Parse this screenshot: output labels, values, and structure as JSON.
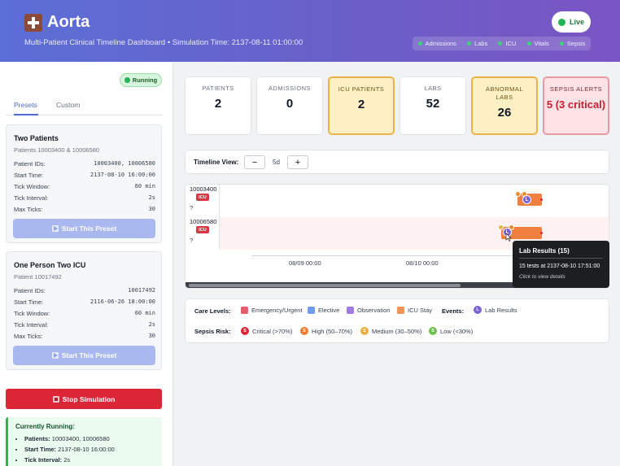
{
  "header": {
    "title": "Aorta",
    "subtitle": "Multi-Patient Clinical Timeline Dashboard • Simulation Time: 2137-08-11 01:00:00",
    "live_label": "Live",
    "streams": [
      "Admissions",
      "Labs",
      "ICU",
      "Vitals",
      "Sepsis"
    ]
  },
  "sidebar": {
    "status": "Running",
    "tabs": [
      "Presets",
      "Custom"
    ],
    "active_tab": "Presets",
    "presets": [
      {
        "title": "Two Patients",
        "subtitle": "Patients 10003400 & 10006580",
        "fields": [
          {
            "label": "Patient IDs:",
            "value": "10003400, 10006580"
          },
          {
            "label": "Start Time:",
            "value": "2137-08-10 16:00:00"
          },
          {
            "label": "Tick Window:",
            "value": "60 min"
          },
          {
            "label": "Tick Interval:",
            "value": "2s"
          },
          {
            "label": "Max Ticks:",
            "value": "30"
          }
        ],
        "button": "Start This Preset"
      },
      {
        "title": "One Person Two ICU",
        "subtitle": "Patient 10017492",
        "fields": [
          {
            "label": "Patient IDs:",
            "value": "10017492"
          },
          {
            "label": "Start Time:",
            "value": "2116-06-26 18:00:00"
          },
          {
            "label": "Tick Window:",
            "value": "60 min"
          },
          {
            "label": "Tick Interval:",
            "value": "2s"
          },
          {
            "label": "Max Ticks:",
            "value": "30"
          }
        ],
        "button": "Start This Preset"
      }
    ],
    "stop_button": "Stop Simulation",
    "currently_running": {
      "title": "Currently Running:",
      "items": [
        {
          "key": "Patients:",
          "value": "10003400, 10006580"
        },
        {
          "key": "Start Time:",
          "value": "2137-08-10 16:00:00"
        },
        {
          "key": "Tick Interval:",
          "value": "2s"
        }
      ]
    }
  },
  "stats": [
    {
      "label": "PATIENTS",
      "value": "2",
      "style": "normal"
    },
    {
      "label": "ADMISSIONS",
      "value": "0",
      "style": "normal"
    },
    {
      "label": "ICU PATIENTS",
      "value": "2",
      "style": "warn"
    },
    {
      "label": "LABS",
      "value": "52",
      "style": "normal"
    },
    {
      "label": "ABNORMAL LABS",
      "value": "26",
      "style": "warn"
    },
    {
      "label": "SEPSIS ALERTS",
      "value": "5 (3 critical)",
      "style": "danger"
    }
  ],
  "timeline": {
    "view_label": "Timeline View:",
    "zoom_out": "−",
    "zoom_in": "+",
    "zoom_value": "5d",
    "rows": [
      {
        "patient_id": "10003400",
        "tag": "ICU",
        "unknown": "?"
      },
      {
        "patient_id": "10006580",
        "tag": "ICU",
        "unknown": "?"
      }
    ],
    "ticks": [
      "08/09 00:00",
      "08/10 00:00"
    ],
    "event_letter": "L",
    "sepsis_letter": "S"
  },
  "tooltip": {
    "title": "Lab Results (15)",
    "detail": "15 tests at 2137-08-10 17:51:00",
    "hint": "Click to view details"
  },
  "legend": {
    "care_title": "Care Levels:",
    "care": [
      {
        "label": "Emergency/Urgent",
        "color": "#e35d6a"
      },
      {
        "label": "Elective",
        "color": "#6f9bef"
      },
      {
        "label": "Observation",
        "color": "#a07be6"
      },
      {
        "label": "ICU Stay",
        "color": "#f0935a"
      }
    ],
    "events_title": "Events:",
    "events": [
      {
        "letter": "L",
        "label": "Lab Results",
        "color": "#7b61d6"
      }
    ],
    "sepsis_title": "Sepsis Risk:",
    "sepsis": [
      {
        "letter": "S",
        "label": "Critical (>70%)",
        "color": "#dc2638"
      },
      {
        "letter": "S",
        "label": "High (50–70%)",
        "color": "#f07a2e"
      },
      {
        "letter": "S",
        "label": "Medium (30–50%)",
        "color": "#e9b03d"
      },
      {
        "letter": "S",
        "label": "Low (<30%)",
        "color": "#6cc04a"
      }
    ]
  }
}
